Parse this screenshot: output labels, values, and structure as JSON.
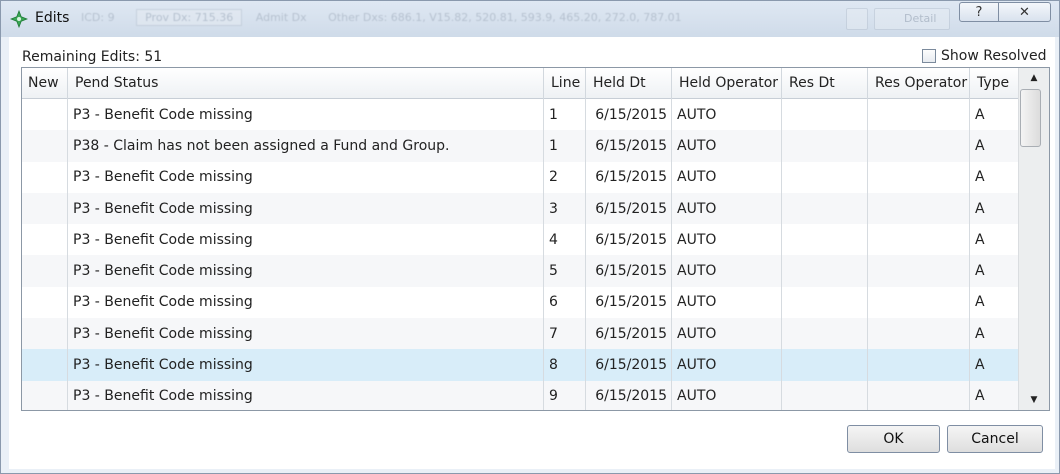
{
  "window": {
    "title": "Edits",
    "background_text": [
      "ICD: 9",
      "Prov Dx: 715.36",
      "Admit Dx",
      "Other Dxs: 686.1, V15.82, 520.81, 593.9, 465.20, 272.0, 787.01",
      "Detail"
    ],
    "help_label": "?",
    "close_label": "✕"
  },
  "summary": {
    "remaining_label": "Remaining Edits: 51",
    "show_resolved_label": "Show Resolved",
    "show_resolved_checked": false
  },
  "grid": {
    "columns": [
      "New",
      "Pend Status",
      "Line",
      "Held Dt",
      "Held Operator",
      "Res Dt",
      "Res Operator",
      "Type"
    ],
    "rows": [
      {
        "new": "",
        "pend_status": "P3 - Benefit Code missing",
        "line": "1",
        "held_dt": "6/15/2015",
        "held_operator": "AUTO",
        "res_dt": "",
        "res_operator": "",
        "type": "A"
      },
      {
        "new": "",
        "pend_status": "P38 - Claim has not been assigned a Fund and Group.",
        "line": "1",
        "held_dt": "6/15/2015",
        "held_operator": "AUTO",
        "res_dt": "",
        "res_operator": "",
        "type": "A"
      },
      {
        "new": "",
        "pend_status": "P3 - Benefit Code missing",
        "line": "2",
        "held_dt": "6/15/2015",
        "held_operator": "AUTO",
        "res_dt": "",
        "res_operator": "",
        "type": "A"
      },
      {
        "new": "",
        "pend_status": "P3 - Benefit Code missing",
        "line": "3",
        "held_dt": "6/15/2015",
        "held_operator": "AUTO",
        "res_dt": "",
        "res_operator": "",
        "type": "A"
      },
      {
        "new": "",
        "pend_status": "P3 - Benefit Code missing",
        "line": "4",
        "held_dt": "6/15/2015",
        "held_operator": "AUTO",
        "res_dt": "",
        "res_operator": "",
        "type": "A"
      },
      {
        "new": "",
        "pend_status": "P3 - Benefit Code missing",
        "line": "5",
        "held_dt": "6/15/2015",
        "held_operator": "AUTO",
        "res_dt": "",
        "res_operator": "",
        "type": "A"
      },
      {
        "new": "",
        "pend_status": "P3 - Benefit Code missing",
        "line": "6",
        "held_dt": "6/15/2015",
        "held_operator": "AUTO",
        "res_dt": "",
        "res_operator": "",
        "type": "A"
      },
      {
        "new": "",
        "pend_status": "P3 - Benefit Code missing",
        "line": "7",
        "held_dt": "6/15/2015",
        "held_operator": "AUTO",
        "res_dt": "",
        "res_operator": "",
        "type": "A"
      },
      {
        "new": "",
        "pend_status": "P3 - Benefit Code missing",
        "line": "8",
        "held_dt": "6/15/2015",
        "held_operator": "AUTO",
        "res_dt": "",
        "res_operator": "",
        "type": "A"
      },
      {
        "new": "",
        "pend_status": "P3 - Benefit Code missing",
        "line": "9",
        "held_dt": "6/15/2015",
        "held_operator": "AUTO",
        "res_dt": "",
        "res_operator": "",
        "type": "A"
      }
    ],
    "selected_row": 8
  },
  "buttons": {
    "ok_label": "OK",
    "cancel_label": "Cancel"
  },
  "icons": {
    "app": "diamond-star-icon",
    "scroll_up": "arrow-up-icon",
    "scroll_down": "arrow-down-icon"
  },
  "colors": {
    "app_icon": "#3aa655",
    "selected_row": "#d8edf9",
    "window_bg": "#eaf0f7"
  }
}
